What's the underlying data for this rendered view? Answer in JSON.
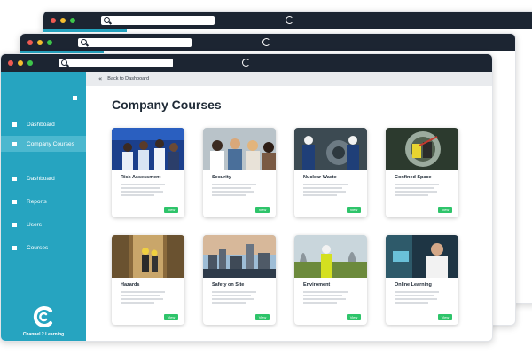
{
  "sidebar": {
    "items": [
      {
        "label": "Dashboard",
        "active": false
      },
      {
        "label": "Company Courses",
        "active": true
      },
      {
        "label": "Dashboard",
        "active": false
      },
      {
        "label": "Reports",
        "active": false
      },
      {
        "label": "Users",
        "active": false
      },
      {
        "label": "Courses",
        "active": false
      }
    ],
    "logo_text": "Channel 2 Learning"
  },
  "topbar": {
    "back_label": "Back to Dashboard"
  },
  "main": {
    "title": "Company Courses"
  },
  "courses": [
    {
      "title": "Risk Assessment",
      "view_label": "View"
    },
    {
      "title": "Security",
      "view_label": "View"
    },
    {
      "title": "Nuclear Waste",
      "view_label": "View"
    },
    {
      "title": "Confined Space",
      "view_label": "View"
    },
    {
      "title": "Hazards",
      "view_label": "View"
    },
    {
      "title": "Safety on Site",
      "view_label": "View"
    },
    {
      "title": "Enviroment",
      "view_label": "View"
    },
    {
      "title": "Online Learning",
      "view_label": "View"
    }
  ],
  "colors": {
    "titlebar": "#1c2532",
    "sidebar": "#26a4c0",
    "accent": "#26a6c2",
    "view_button": "#2ec46a"
  },
  "icons": [
    "search-icon",
    "reload-icon",
    "back-chevrons-icon",
    "menu-toggle-icon",
    "logo-icon"
  ]
}
